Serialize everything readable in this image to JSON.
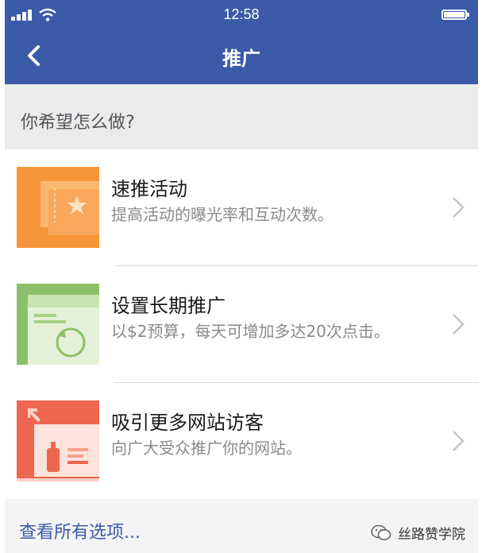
{
  "status": {
    "time": "12:58"
  },
  "header": {
    "title": "推广"
  },
  "question": "你希望怎么做?",
  "options": [
    {
      "title": "速推活动",
      "subtitle": "提高活动的曝光率和互动次数。",
      "icon": "ticket-star-icon",
      "color": "#f7953a"
    },
    {
      "title": "设置长期推广",
      "subtitle": "以$2预算，每天可增加多达20次点击。",
      "icon": "page-cycle-icon",
      "color": "#8dc06a"
    },
    {
      "title": "吸引更多网站访客",
      "subtitle": "向广大受众推广你的网站。",
      "icon": "website-card-icon",
      "color": "#ee6650"
    }
  ],
  "footer": {
    "more_label": "查看所有选项..."
  },
  "watermark": {
    "text": "丝路赞学院"
  },
  "colors": {
    "header": "#3b5aa8",
    "link": "#3b5aa8"
  }
}
